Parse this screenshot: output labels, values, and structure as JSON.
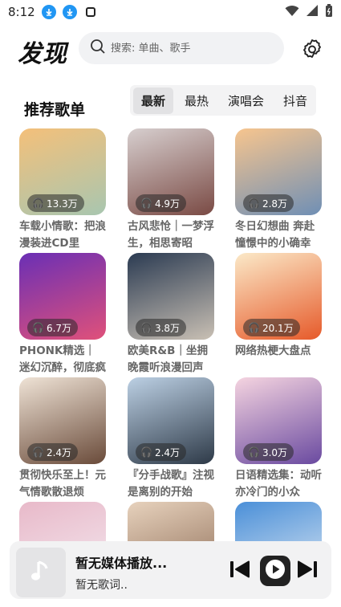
{
  "status": {
    "time": "8:12"
  },
  "header": {
    "logo": "发现",
    "search_placeholder": "搜索: 单曲、歌手"
  },
  "section": {
    "title": "推荐歌单"
  },
  "tabs": [
    {
      "label": "最新",
      "active": true
    },
    {
      "label": "最热",
      "active": false
    },
    {
      "label": "演唱会",
      "active": false
    },
    {
      "label": "抖音",
      "active": false
    }
  ],
  "playlists": [
    {
      "plays": "13.3万",
      "title": "车载小情歌：把浪漫装进CD里",
      "colors": [
        "#f4c07a",
        "#a8c6b0"
      ]
    },
    {
      "plays": "4.9万",
      "title": "古风悲怆｜一梦浮生，相思寄昭",
      "colors": [
        "#d7cfcf",
        "#7a4a44"
      ]
    },
    {
      "plays": "2.8万",
      "title": "冬日幻想曲 奔赴憧憬中的小确幸",
      "colors": [
        "#f7c58e",
        "#6f8fb5"
      ]
    },
    {
      "plays": "6.7万",
      "title": "PHONK精选｜迷幻沉醉，彻底疯",
      "colors": [
        "#6a2fb5",
        "#e0517a"
      ]
    },
    {
      "plays": "3.8万",
      "title": "欧美R&B｜坐拥晚霞听浪漫回声",
      "colors": [
        "#2b3b52",
        "#c9c0b4"
      ]
    },
    {
      "plays": "20.1万",
      "title": "网络热梗大盘点",
      "colors": [
        "#fbe9c8",
        "#e65a2a"
      ]
    },
    {
      "plays": "2.4万",
      "title": "贯彻快乐至上！元气情歌散退烦",
      "colors": [
        "#efe3d6",
        "#6a4b3a"
      ]
    },
    {
      "plays": "2.4万",
      "title": "『分手战歌』注视是离别的开始",
      "colors": [
        "#bcd0e4",
        "#2e3a48"
      ]
    },
    {
      "plays": "3.0万",
      "title": "日语精选集：动听亦冷门的小众",
      "colors": [
        "#f5d4e0",
        "#6a4aa0"
      ]
    },
    {
      "plays": "",
      "title": "",
      "colors": [
        "#e8b9c9",
        "#f4e9f0"
      ]
    },
    {
      "plays": "",
      "title": "",
      "colors": [
        "#e7d2bd",
        "#8c6b55"
      ]
    },
    {
      "plays": "",
      "title": "",
      "colors": [
        "#4a8fd8",
        "#dfe9f3"
      ]
    }
  ],
  "player": {
    "title": "暂无媒体播放...",
    "lyrics": "暂无歌词.."
  },
  "colors": {
    "download_badge": "#2196f3",
    "player_bg": "#f2f2f3"
  }
}
